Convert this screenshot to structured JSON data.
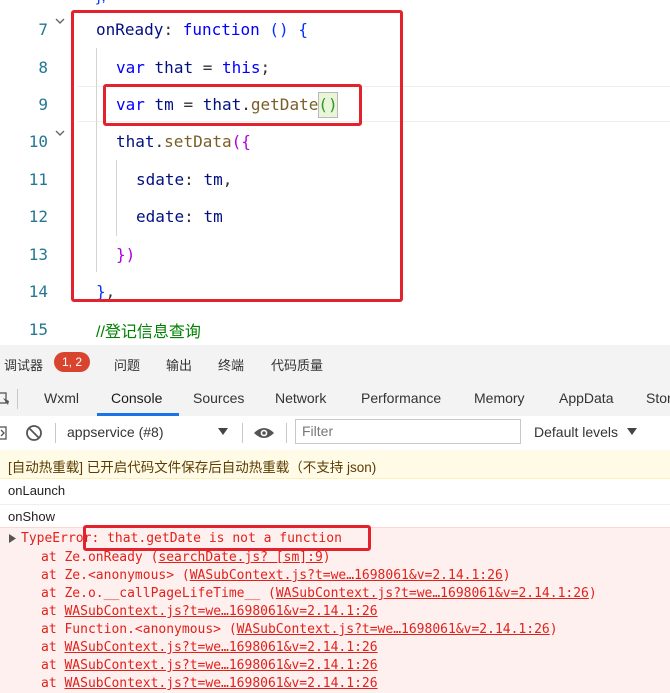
{
  "editor": {
    "line_numbers": [
      "7",
      "8",
      "9",
      "10",
      "11",
      "12",
      "13",
      "14",
      "15"
    ],
    "lines": {
      "l7": {
        "prop": "onReady",
        "colon": ":",
        "kw": "function",
        "parens": "()",
        "brace": "{"
      },
      "l8": {
        "kw": "var",
        "name": "that",
        "eq": "=",
        "val": "this",
        "semi": ";"
      },
      "l9": {
        "kw": "var",
        "name": "tm",
        "eq": "=",
        "obj": "that",
        "dot": ".",
        "method": "getDate",
        "open": "(",
        "close": ")"
      },
      "l10": {
        "obj": "that",
        "dot": ".",
        "method": "setData",
        "open": "(",
        "brace": "{"
      },
      "l11": {
        "key": "sdate",
        "colon": ":",
        "val": "tm",
        "comma": ","
      },
      "l12": {
        "key": "edate",
        "colon": ":",
        "val": "tm"
      },
      "l13": {
        "brace": "}",
        "close": ")"
      },
      "l14": {
        "brace": "}",
        "comma": ","
      },
      "l15": {
        "comment": "//登记信息查询"
      }
    }
  },
  "devtools": {
    "top_tabs": {
      "debugger": "调试器",
      "badge": "1, 2",
      "issues": "问题",
      "output": "输出",
      "terminal": "终端",
      "code_quality": "代码质量"
    },
    "tabs": [
      "Wxml",
      "Console",
      "Sources",
      "Network",
      "Performance",
      "Memory",
      "AppData",
      "Stor"
    ],
    "toolbar": {
      "context": "appservice (#8)",
      "filter_placeholder": "Filter",
      "levels": "Default levels"
    },
    "console": {
      "hot_reload": "[自动热重载] 已开启代码文件保存后自动热重载（不支持 json)",
      "row1": "onLaunch",
      "row2": "onShow",
      "error_title": "TypeError: that.getDate is not a function",
      "stack": [
        {
          "pre": "at Ze.onReady (",
          "link": "searchDate.js? [sm]:9",
          "post": ")"
        },
        {
          "pre": "at Ze.<anonymous> (",
          "link": "WASubContext.js?t=we…1698061&v=2.14.1:26",
          "post": ")"
        },
        {
          "pre": "at Ze.o.__callPageLifeTime__ (",
          "link": "WASubContext.js?t=we…1698061&v=2.14.1:26",
          "post": ")"
        },
        {
          "pre": "at ",
          "link": "WASubContext.js?t=we…1698061&v=2.14.1:26",
          "post": ""
        },
        {
          "pre": "at Function.<anonymous> (",
          "link": "WASubContext.js?t=we…1698061&v=2.14.1:26",
          "post": ")"
        },
        {
          "pre": "at ",
          "link": "WASubContext.js?t=we…1698061&v=2.14.1:26",
          "post": ""
        },
        {
          "pre": "at ",
          "link": "WASubContext.js?t=we…1698061&v=2.14.1:26",
          "post": ""
        },
        {
          "pre": "at ",
          "link": "WASubContext.js?t=we…1698061&v=2.14.1:26",
          "post": ""
        }
      ]
    }
  },
  "colors": {
    "accent": "#1a73e8",
    "error": "#e0221b",
    "annotation": "#e4222d",
    "badge": "#d9442f"
  }
}
